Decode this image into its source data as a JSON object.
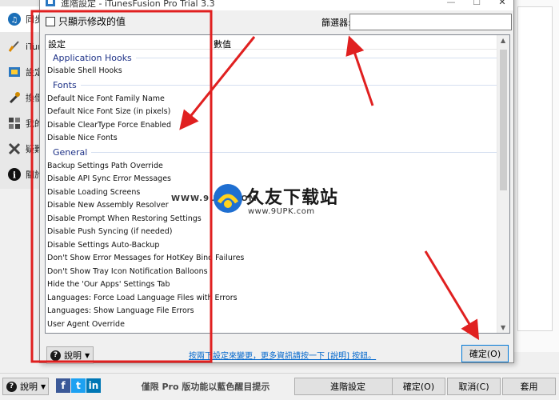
{
  "main_window": {
    "sidebar": {
      "items": [
        {
          "label": "同步",
          "icon": "sync-icon"
        },
        {
          "label": "iTun",
          "icon": "itunes-icon"
        },
        {
          "label": "設定",
          "icon": "settings-icon"
        },
        {
          "label": "換價",
          "icon": "tools-icon"
        },
        {
          "label": "我的",
          "icon": "plugins-icon"
        },
        {
          "label": "疑難",
          "icon": "troubleshoot-icon"
        },
        {
          "label": "關於",
          "icon": "info-icon"
        }
      ]
    },
    "bottom_bar": {
      "help_label": "說明",
      "social": [
        "f",
        "t",
        "in"
      ],
      "pro_notice": "僅限 Pro 版功能以藍色醒目提示",
      "advanced_settings_label": "進階設定",
      "ok_label": "確定(O)",
      "cancel_label": "取消(C)",
      "apply_label": "套用"
    }
  },
  "dialog": {
    "title": "進階設定 - iTunesFusion Pro Trial 3.3",
    "controls": {
      "minimize": "—",
      "maximize": "☐",
      "close": "✕"
    },
    "show_modified_label": "只顯示修改的值",
    "filter_label": "篩選器:",
    "filter_value": "",
    "columns": {
      "setting": "設定",
      "value": "數值"
    },
    "groups": [
      {
        "name": "Application Hooks",
        "items": [
          "Disable Shell Hooks"
        ]
      },
      {
        "name": "Fonts",
        "items": [
          "Default Nice Font Family Name",
          "Default Nice Font Size (in pixels)",
          "Disable ClearType Force Enabled",
          "Disable Nice Fonts"
        ]
      },
      {
        "name": "General",
        "items": [
          "Backup Settings Path Override",
          "Disable API Sync Error Messages",
          "Disable Loading Screens",
          "Disable New Assembly Resolver",
          "Disable Prompt When Restoring Settings",
          "Disable Push Syncing (if needed)",
          "Disable Settings Auto-Backup",
          "Don't Show Error Messages for HotKey Bind Failures",
          "Don't Show Tray Icon Notification Balloons",
          "Hide the 'Our Apps' Settings Tab",
          "Languages: Force Load Language Files with Errors",
          "Languages: Show Language File Errors",
          "User Agent Override"
        ]
      }
    ],
    "help_label": "說明",
    "hint_text": "按兩下設定來變更，更多資訊請按一下 [說明] 按鈕。",
    "ok_label": "確定(O)"
  },
  "watermark": {
    "site_left": "WWW.9UPK.COM",
    "brand": "久友下载站",
    "site": "www.9UPK.com"
  },
  "colors": {
    "group_header": "#1e3287",
    "annotation_red": "#e02020",
    "link": "#0066cc"
  }
}
